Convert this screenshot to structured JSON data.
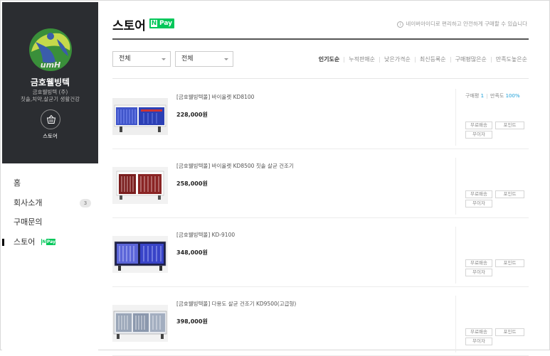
{
  "sidebar": {
    "logo_text": "umH",
    "company_name": "금호웰빙텍",
    "company_sub": "금호웰빙텍 (주)",
    "company_desc": "칫솔,치약,살균기 생활건강",
    "store_label": "스토어",
    "nav": [
      {
        "label": "홈"
      },
      {
        "label": "회사소개",
        "badge": "3"
      },
      {
        "label": "구매문의"
      },
      {
        "label": "스토어",
        "pay": "Pay",
        "pay_n": "N"
      }
    ]
  },
  "header": {
    "title": "스토어",
    "npay_n": "N",
    "npay_text": "Pay",
    "notice_icon": "i",
    "notice": "네이버아이디로 편리하고 안전하게 구매할 수 있습니다"
  },
  "filters": {
    "select1": "전체",
    "select2": "전체",
    "sorts": [
      "인기도순",
      "누적판매순",
      "낮은가격순",
      "최신등록순",
      "구매평많은순",
      "만족도높은순"
    ]
  },
  "products": [
    {
      "name": "[금호웰빙텍몰] 바이올렛 KD8100",
      "price": "228,000원",
      "review_label": "구매평",
      "review_count": "1",
      "sat_label": "만족도",
      "sat_value": "100%",
      "tags": [
        "무료배송",
        "포인트",
        "무이자"
      ]
    },
    {
      "name": "[금호웰빙텍몰] 바이올렛 KD8500 칫솔 살균 건조기",
      "price": "258,000원",
      "tags": [
        "무료배송",
        "포인트",
        "무이자"
      ]
    },
    {
      "name": "[금호웰빙텍몰] KD-9100",
      "price": "348,000원",
      "tags": [
        "무료배송",
        "포인트",
        "무이자"
      ]
    },
    {
      "name": "[금호웰빙텍몰] 다용도 살균 건조기 KD9500(고급형)",
      "price": "398,000원",
      "tags": [
        "무료배송",
        "포인트",
        "무이자"
      ]
    }
  ],
  "colors": {
    "sidebar_bg": "#2b2d31",
    "npay_green": "#03c75a",
    "stat_blue": "#1a9fd8"
  }
}
